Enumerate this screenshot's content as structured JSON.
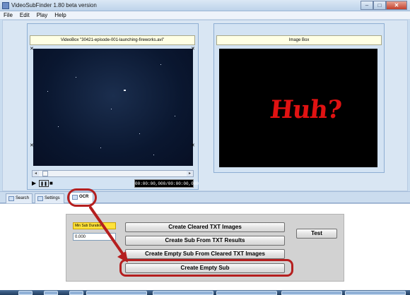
{
  "window": {
    "title": "VideoSubFinder 1.80 beta version",
    "minimize_glyph": "–",
    "maximize_glyph": "□",
    "close_glyph": "✕"
  },
  "menu": {
    "items": [
      "File",
      "Edit",
      "Play",
      "Help"
    ]
  },
  "video_panel": {
    "title": "VideoBox \"30421-episode-001-launching-fireworks.avi\"",
    "play_glyph": "▶",
    "pause_glyph": "❚❚",
    "stop_glyph": "■",
    "scroll_left_glyph": "◂",
    "scroll_right_glyph": "▸",
    "timecode": "00:00:00,000/00:00:00,000"
  },
  "image_panel": {
    "title": "Image Box",
    "image_text": "Huh?"
  },
  "tabs": [
    {
      "label": "Search",
      "active": false
    },
    {
      "label": "Settings",
      "active": false
    },
    {
      "label": "OCR",
      "active": true
    }
  ],
  "ocr": {
    "min_sub_duration_label": "Min Sub Duration:",
    "min_sub_duration_value": "0.000",
    "buttons": {
      "create_cleared_txt_images": "Create Cleared TXT Images",
      "create_sub_from_txt_results": "Create Sub From TXT Results",
      "create_empty_sub_from_cleared": "Create Empty Sub From Cleared TXT Images",
      "create_empty_sub": "Create Empty Sub",
      "test": "Test"
    }
  },
  "annotation": {
    "color": "#b51f1f"
  },
  "icons": {
    "app": "app-icon",
    "tab": "tab-page-icon"
  }
}
